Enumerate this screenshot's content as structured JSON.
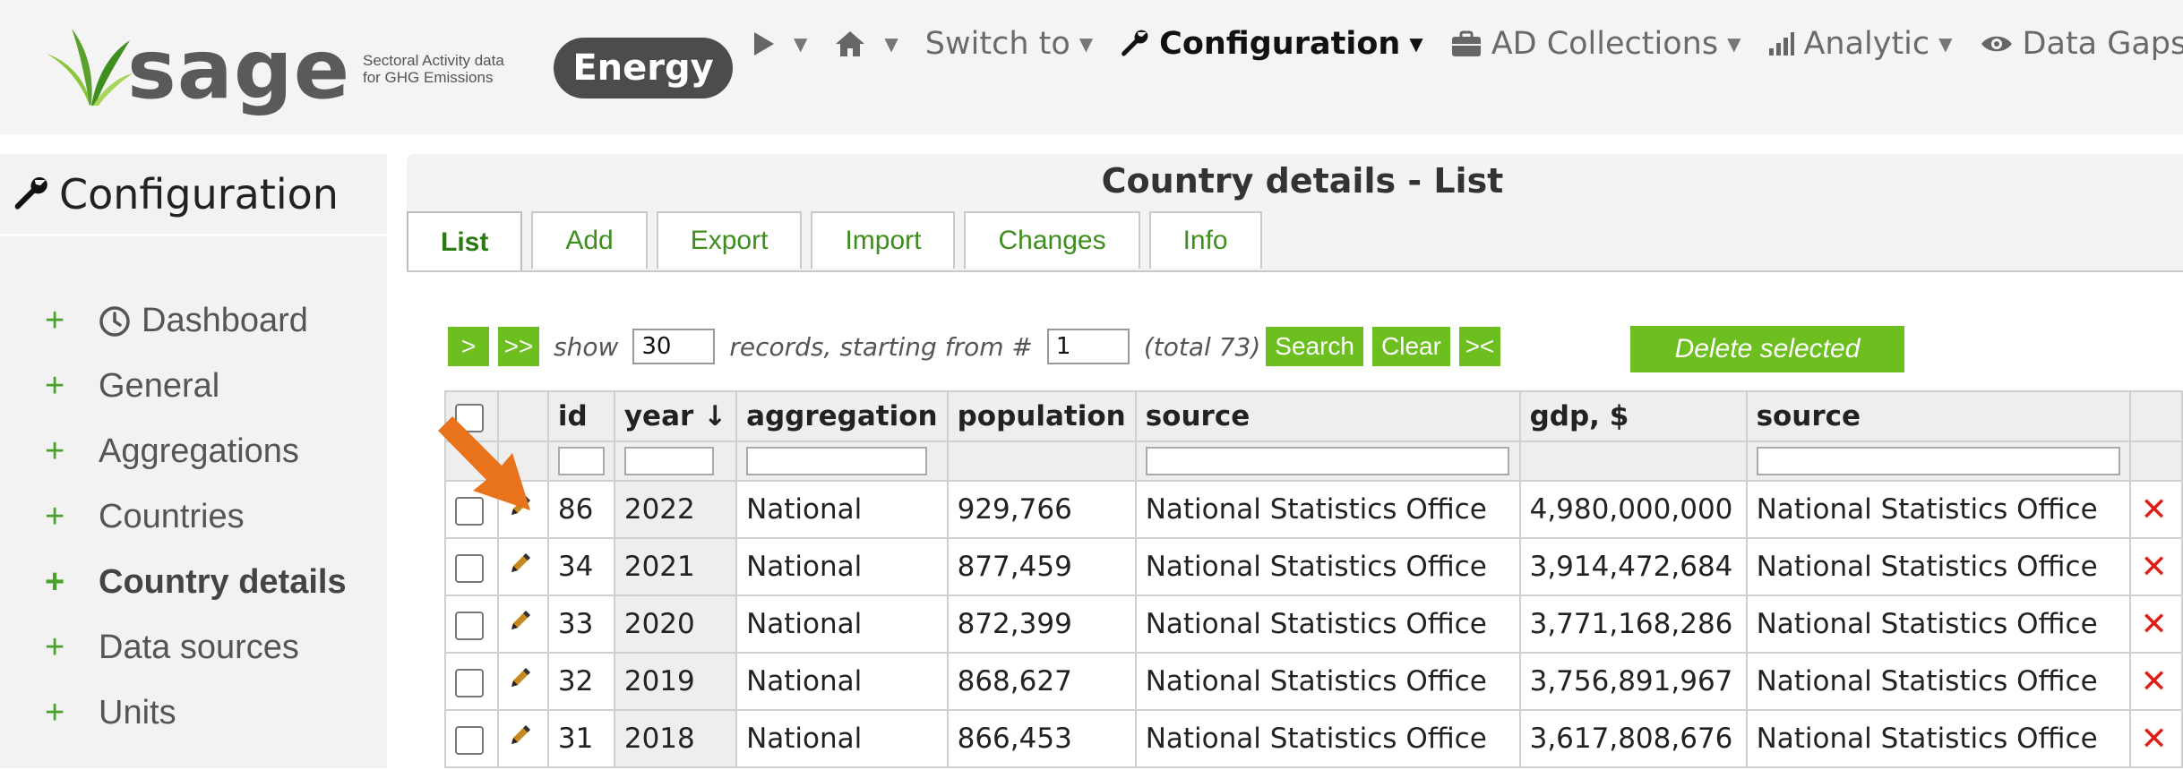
{
  "header": {
    "logo_word": "sage",
    "logo_tag_line1": "Sectoral Activity data",
    "logo_tag_line2": "for GHG Emissions",
    "sector_badge": "Energy",
    "menu": [
      {
        "label": "Switch to"
      },
      {
        "label": "Configuration"
      },
      {
        "label": "AD Collections"
      },
      {
        "label": "Analytic"
      },
      {
        "label": "Data Gaps"
      }
    ]
  },
  "sidebar": {
    "title": "Configuration",
    "items": [
      {
        "label": "Dashboard"
      },
      {
        "label": "General"
      },
      {
        "label": "Aggregations"
      },
      {
        "label": "Countries"
      },
      {
        "label": "Country details"
      },
      {
        "label": "Data sources"
      },
      {
        "label": "Units"
      }
    ],
    "plus": "+"
  },
  "main": {
    "title": "Country details - List",
    "tabs": [
      "List",
      "Add",
      "Export",
      "Import",
      "Changes",
      "Info"
    ],
    "controls": {
      "next": ">",
      "last": ">>",
      "show_label": "show",
      "records_value": "30",
      "records_label": "records, starting from #",
      "start_value": "1",
      "total_label": "(total 73)",
      "search": "Search",
      "clear": "Clear",
      "collapse": "><",
      "delete_selected": "Delete selected"
    },
    "table": {
      "headers": {
        "id": "id",
        "year": "year ↓",
        "aggregation": "aggregation",
        "population": "population",
        "source1": "source",
        "gdp": "gdp, $",
        "source2": "source"
      },
      "rows": [
        {
          "id": "86",
          "year": "2022",
          "aggregation": "National",
          "population": "929,766",
          "source1": "National Statistics Office",
          "gdp": "4,980,000,000",
          "source2": "National Statistics Office"
        },
        {
          "id": "34",
          "year": "2021",
          "aggregation": "National",
          "population": "877,459",
          "source1": "National Statistics Office",
          "gdp": "3,914,472,684",
          "source2": "National Statistics Office"
        },
        {
          "id": "33",
          "year": "2020",
          "aggregation": "National",
          "population": "872,399",
          "source1": "National Statistics Office",
          "gdp": "3,771,168,286",
          "source2": "National Statistics Office"
        },
        {
          "id": "32",
          "year": "2019",
          "aggregation": "National",
          "population": "868,627",
          "source1": "National Statistics Office",
          "gdp": "3,756,891,967",
          "source2": "National Statistics Office"
        },
        {
          "id": "31",
          "year": "2018",
          "aggregation": "National",
          "population": "866,453",
          "source1": "National Statistics Office",
          "gdp": "3,617,808,676",
          "source2": "National Statistics Office"
        }
      ],
      "delete_glyph": "✕",
      "edit_icon": "pencil-icon"
    }
  },
  "colors": {
    "accent_green": "#6cbf1f",
    "tab_green": "#3e8e1e",
    "delete_red": "#e21b1b",
    "badge_dark": "#4c4c4c",
    "arrow_orange": "#e8731c"
  }
}
